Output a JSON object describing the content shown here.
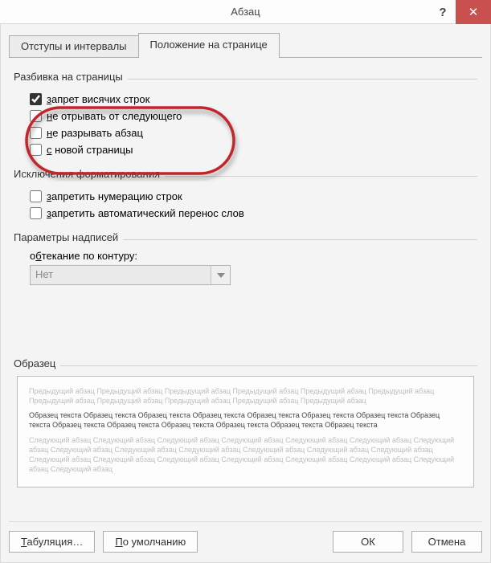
{
  "window": {
    "title": "Абзац"
  },
  "tabs": {
    "indent_spacing": "Отступы и интервалы",
    "page_position": "Положение на странице"
  },
  "groups": {
    "pagination": {
      "title": "Разбивка на страницы",
      "widow_orphan": "запрет висячих строк",
      "keep_with_next": "не отрывать от следующего",
      "keep_lines_together": "не разрывать абзац",
      "page_break_before": "с новой страницы"
    },
    "format_exceptions": {
      "title": "Исключения форматирования",
      "suppress_line_numbers": "запретить нумерацию строк",
      "suppress_hyphenation": "запретить автоматический перенос слов"
    },
    "caption_params": {
      "title": "Параметры надписей",
      "wrap_label": "обтекание по контуру:",
      "wrap_value": "Нет"
    },
    "sample": {
      "title": "Образец",
      "prev": "Предыдущий абзац Предыдущий абзац Предыдущий абзац Предыдущий абзац Предыдущий абзац Предыдущий абзац Предыдущий абзац Предыдущий абзац Предыдущий абзац Предыдущий абзац Предыдущий абзац",
      "body": "Образец текста Образец текста Образец текста Образец текста Образец текста Образец текста Образец текста Образец текста Образец текста Образец текста Образец текста Образец текста Образец текста Образец текста",
      "next": "Следующий абзац Следующий абзац Следующий абзац Следующий абзац Следующий абзац Следующий абзац Следующий абзац Следующий абзац Следующий абзац Следующий абзац Следующий абзац Следующий абзац Следующий абзац Следующий абзац Следующий абзац Следующий абзац Следующий абзац Следующий абзац Следующий абзац Следующий абзац Следующий абзац"
    }
  },
  "buttons": {
    "tabs": "Табуляция…",
    "default": "По умолчанию",
    "ok": "ОК",
    "cancel": "Отмена"
  },
  "state": {
    "widow_orphan_checked": true,
    "keep_with_next_checked": false,
    "keep_lines_together_checked": false,
    "page_break_before_checked": false,
    "suppress_line_numbers_checked": false,
    "suppress_hyphenation_checked": false,
    "wrap_disabled": true
  }
}
